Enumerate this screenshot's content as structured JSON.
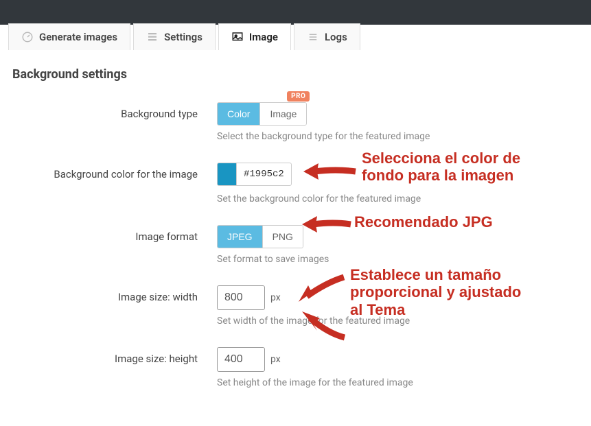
{
  "annotation_color": "#c62e22",
  "tabs": {
    "generate": "Generate images",
    "settings": "Settings",
    "image": "Image",
    "logs": "Logs"
  },
  "section_title": "Background settings",
  "fields": {
    "bg_type": {
      "label": "Background type",
      "option_color": "Color",
      "option_image": "Image",
      "badge": "PRO",
      "help": "Select the background type for the featured image"
    },
    "bg_color": {
      "label": "Background color for the image",
      "value": "#1995c2",
      "help": "Set the background color for the featured image"
    },
    "img_format": {
      "label": "Image format",
      "option_jpeg": "JPEG",
      "option_png": "PNG",
      "help": "Set format to save images"
    },
    "width": {
      "label": "Image size: width",
      "value": "800",
      "unit": "px",
      "help": "Set width of the image for the featured image"
    },
    "height": {
      "label": "Image size: height",
      "value": "400",
      "unit": "px",
      "help": "Set height of the image for the featured image"
    }
  },
  "annotations": {
    "color": "Selecciona el color de\nfondo para la imagen",
    "format": "Recomendado JPG",
    "size": "Establece un tamaño\nproporcional y ajustado\nal Tema"
  }
}
